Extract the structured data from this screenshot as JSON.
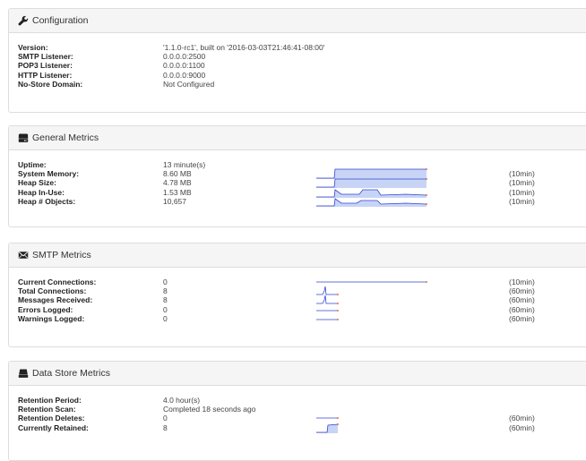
{
  "configuration": {
    "title": "Configuration",
    "icon": "wrench-icon",
    "rows": [
      {
        "label": "Version:",
        "value": "'1.1.0-rc1', built on '2016-03-03T21:46:41-08:00'"
      },
      {
        "label": "SMTP Listener:",
        "value": "0.0.0.0:2500"
      },
      {
        "label": "POP3 Listener:",
        "value": "0.0.0.0:1100"
      },
      {
        "label": "HTTP Listener:",
        "value": "0.0.0.0:9000"
      },
      {
        "label": "No-Store Domain:",
        "value": "Not Configured"
      }
    ]
  },
  "general_metrics": {
    "title": "General Metrics",
    "icon": "hdd-icon",
    "rows": [
      {
        "label": "Uptime:",
        "value": "13 minute(s)",
        "period": ""
      },
      {
        "label": "System Memory:",
        "value": "8.60 MB",
        "period": "(10min)"
      },
      {
        "label": "Heap Size:",
        "value": "4.78 MB",
        "period": "(10min)"
      },
      {
        "label": "Heap In-Use:",
        "value": "1.53 MB",
        "period": "(10min)"
      },
      {
        "label": "Heap # Objects:",
        "value": "10,657",
        "period": "(10min)"
      }
    ]
  },
  "smtp_metrics": {
    "title": "SMTP Metrics",
    "icon": "envelope-icon",
    "rows": [
      {
        "label": "Current Connections:",
        "value": "0",
        "period": "(10min)"
      },
      {
        "label": "Total Connections:",
        "value": "8",
        "period": "(60min)"
      },
      {
        "label": "Messages Received:",
        "value": "8",
        "period": "(60min)"
      },
      {
        "label": "Errors Logged:",
        "value": "0",
        "period": "(60min)"
      },
      {
        "label": "Warnings Logged:",
        "value": "0",
        "period": "(60min)"
      }
    ]
  },
  "data_store_metrics": {
    "title": "Data Store Metrics",
    "icon": "database-icon",
    "rows": [
      {
        "label": "Retention Period:",
        "value": "4.0 hour(s)",
        "period": ""
      },
      {
        "label": "Retention Scan:",
        "value": "Completed 18 seconds ago",
        "period": ""
      },
      {
        "label": "Retention Deletes:",
        "value": "0",
        "period": "(60min)"
      },
      {
        "label": "Currently Retained:",
        "value": "8",
        "period": "(60min)"
      }
    ]
  },
  "colors": {
    "spark_line": "#3344cc",
    "spark_fill": "#c8d4f6",
    "spark_end": "#e05020"
  }
}
